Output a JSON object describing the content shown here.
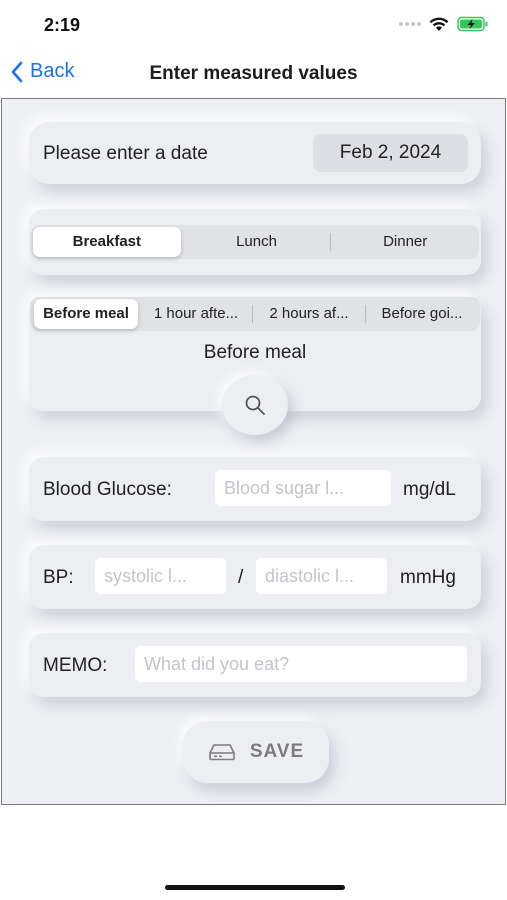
{
  "status_bar": {
    "time": "2:19"
  },
  "nav": {
    "back_label": "Back",
    "title": "Enter measured values"
  },
  "date": {
    "label": "Please enter a date",
    "value": "Feb 2, 2024"
  },
  "meal_tabs": {
    "items": [
      "Breakfast",
      "Lunch",
      "Dinner"
    ],
    "selected": "Breakfast"
  },
  "timing_tabs": {
    "items": [
      "Before meal",
      "1 hour afte...",
      "2 hours af...",
      "Before goi..."
    ],
    "selected": "Before meal",
    "selected_display": "Before meal"
  },
  "glucose": {
    "label": "Blood Glucose:",
    "placeholder": "Blood sugar l...",
    "unit": "mg/dL"
  },
  "bp": {
    "label": "BP:",
    "systolic_placeholder": "systolic l...",
    "separator": "/",
    "diastolic_placeholder": "diastolic l...",
    "unit": "mmHg"
  },
  "memo": {
    "label": "MEMO:",
    "placeholder": "What did you eat?"
  },
  "save": {
    "label": "SAVE",
    "icon": "disk-drive-icon"
  },
  "icons": {
    "back": "chevron-left-icon",
    "search": "magnifying-glass-icon",
    "wifi": "wifi-icon",
    "battery": "battery-charging-icon"
  },
  "colors": {
    "accent": "#1a73e8",
    "battery": "#34c759",
    "background": "#eceef2"
  }
}
